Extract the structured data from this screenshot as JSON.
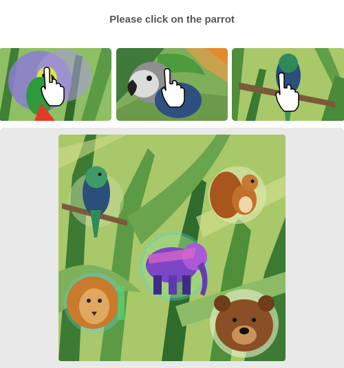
{
  "captcha": {
    "prompt": "Please click on the parrot"
  },
  "examples": [
    {
      "animal": "parrot",
      "cursor_icon": "hand-pointer-icon"
    },
    {
      "animal": "parrot",
      "cursor_icon": "hand-pointer-icon"
    },
    {
      "animal": "parrot",
      "cursor_icon": "hand-pointer-icon"
    }
  ],
  "scene": {
    "background": "jungle-leaves",
    "animals": [
      "parrot",
      "squirrel",
      "elephant",
      "lion",
      "bear"
    ]
  },
  "colors": {
    "stage_bg": "#e9e9e9",
    "prompt_text": "#555555",
    "leaf_dark": "#3d7a34",
    "leaf_light": "#a9c86a"
  }
}
